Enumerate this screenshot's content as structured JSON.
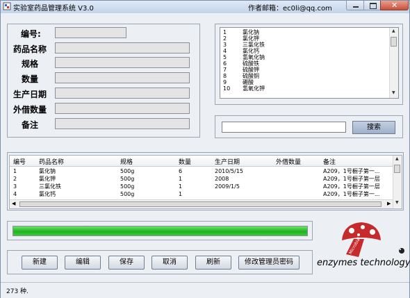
{
  "window": {
    "title": "实验室药品管理系统 V3.0",
    "author": "作者邮箱：ec0li@qq.com"
  },
  "form": {
    "labels": [
      "编号:",
      "药品名称",
      "规格",
      "数量",
      "生产日期",
      "外借数量",
      "备注"
    ]
  },
  "list": {
    "rows": [
      {
        "num": "1",
        "name": "氯化钠"
      },
      {
        "num": "2",
        "name": "氯化钾"
      },
      {
        "num": "3",
        "name": "三氯化铁"
      },
      {
        "num": "4",
        "name": "氯化钙"
      },
      {
        "num": "5",
        "name": "氢氧化钠"
      },
      {
        "num": "6",
        "name": "硫酸铁"
      },
      {
        "num": "7",
        "name": "硫酸钾"
      },
      {
        "num": "8",
        "name": "硫酸铜"
      },
      {
        "num": "9",
        "name": "硼酸"
      },
      {
        "num": "10",
        "name": "氢氧化钾"
      }
    ]
  },
  "search": {
    "button_label": "搜索"
  },
  "table": {
    "headers": [
      "编号",
      "药品名称",
      "规格",
      "数量",
      "生产日期",
      "外借数量",
      "备注"
    ],
    "rows": [
      [
        "1",
        "氯化钠",
        "500g",
        "6",
        "2010/5/15",
        "",
        "A209，1号橱子第一..."
      ],
      [
        "2",
        "氯化钾",
        "500g",
        "1",
        "2008",
        "",
        "A209，1号橱子第一层"
      ],
      [
        "3",
        "三氯化铁",
        "500g",
        "1",
        "2009/1/5",
        "",
        "A209，1号橱子第一层"
      ],
      [
        "4",
        "氯化钙",
        "500g",
        "1",
        "",
        "",
        "A209，1号橱子第一..."
      ]
    ]
  },
  "progress": {
    "value": 1.0,
    "color": "#1fb51f"
  },
  "buttons": {
    "new": "新建",
    "edit": "编辑",
    "save": "保存",
    "cancel": "取消",
    "refresh": "刷新",
    "change_password": "修改管理员密码"
  },
  "logo": {
    "text": "enzymes technology",
    "stem_text": "Microbial"
  },
  "status": {
    "text": "273 种."
  }
}
